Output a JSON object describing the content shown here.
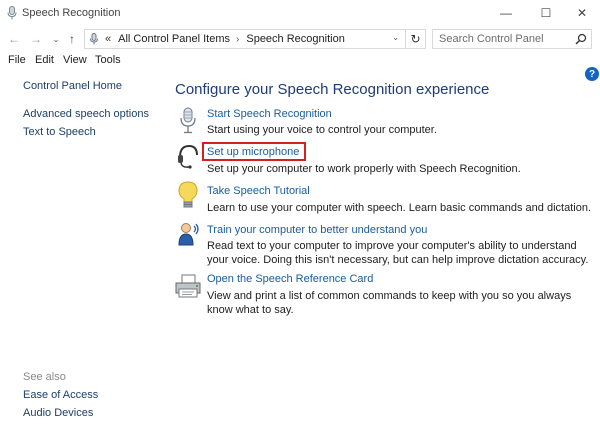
{
  "window": {
    "title": "Speech Recognition",
    "controls": {
      "minimize": "—",
      "maximize": "☐",
      "close": "✕"
    }
  },
  "nav": {
    "back_icon": "←",
    "forward_icon": "→",
    "dropdown_icon": "⌄",
    "up_icon": "↑",
    "chevron": "«",
    "separator": "›",
    "refresh_icon": "↻"
  },
  "address": {
    "crumbs": [
      "All Control Panel Items",
      "Speech Recognition"
    ]
  },
  "search": {
    "placeholder": "Search Control Panel"
  },
  "menubar": {
    "items": [
      "File",
      "Edit",
      "View",
      "Tools"
    ]
  },
  "help": {
    "label": "?"
  },
  "sidebar": {
    "home": "Control Panel Home",
    "links": [
      "Advanced speech options",
      "Text to Speech"
    ],
    "see_also_label": "See also",
    "see_also": [
      "Ease of Access",
      "Audio Devices"
    ]
  },
  "main": {
    "title": "Configure your Speech Recognition experience",
    "tasks": [
      {
        "icon": "microphone-icon",
        "link": "Start Speech Recognition",
        "desc": "Start using your voice to control your computer."
      },
      {
        "icon": "headset-icon",
        "link": "Set up microphone",
        "desc": "Set up your computer to work properly with Speech Recognition.",
        "highlighted": true
      },
      {
        "icon": "lightbulb-icon",
        "link": "Take Speech Tutorial",
        "desc": "Learn to use your computer with speech.  Learn basic commands and dictation."
      },
      {
        "icon": "user-voice-icon",
        "link": "Train your computer to better understand you",
        "desc": "Read text to your computer to improve your computer's ability to understand your voice.  Doing this isn't necessary, but can help improve dictation accuracy."
      },
      {
        "icon": "printer-icon",
        "link": "Open the Speech Reference Card",
        "desc": "View and print a list of common commands to keep with you so you always know what to say."
      }
    ]
  },
  "colors": {
    "link": "#1a5c9e",
    "title": "#1e3c78",
    "highlight": "#d62020",
    "help": "#1565c0"
  }
}
